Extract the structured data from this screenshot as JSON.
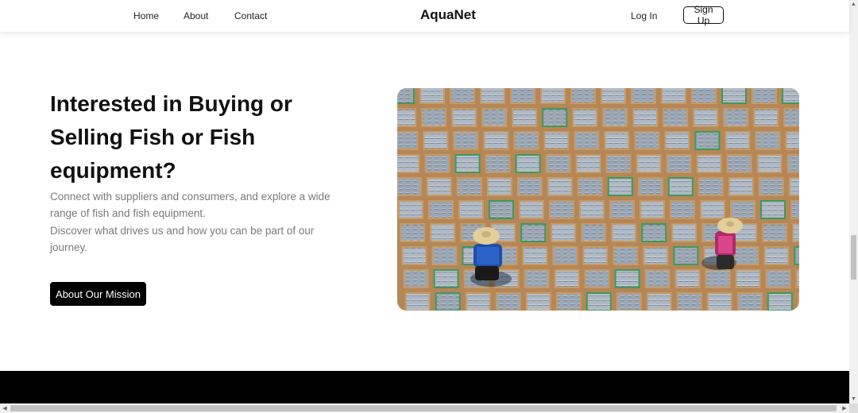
{
  "header": {
    "nav": [
      "Home",
      "About",
      "Contact"
    ],
    "brand": "AquaNet",
    "login_label": "Log In",
    "signup_label": "Sign Up"
  },
  "hero": {
    "headline": "Interested in Buying or Selling Fish or Fish equipment?",
    "description_1": "Connect with suppliers and consumers, and explore a wide range of fish and fish equipment.",
    "description_2": "Discover what drives us and how you can be part of our journey.",
    "cta_label": "About Our Mission",
    "image_subject": "aerial view of workers drying fish in crates"
  },
  "scrollbars": {
    "up_arrow": "▲",
    "down_arrow": "▼",
    "left_arrow": "◀",
    "right_arrow": "▶"
  },
  "colors": {
    "accent": "#000000",
    "muted_text": "#7a7a7a",
    "footer": "#000000"
  }
}
